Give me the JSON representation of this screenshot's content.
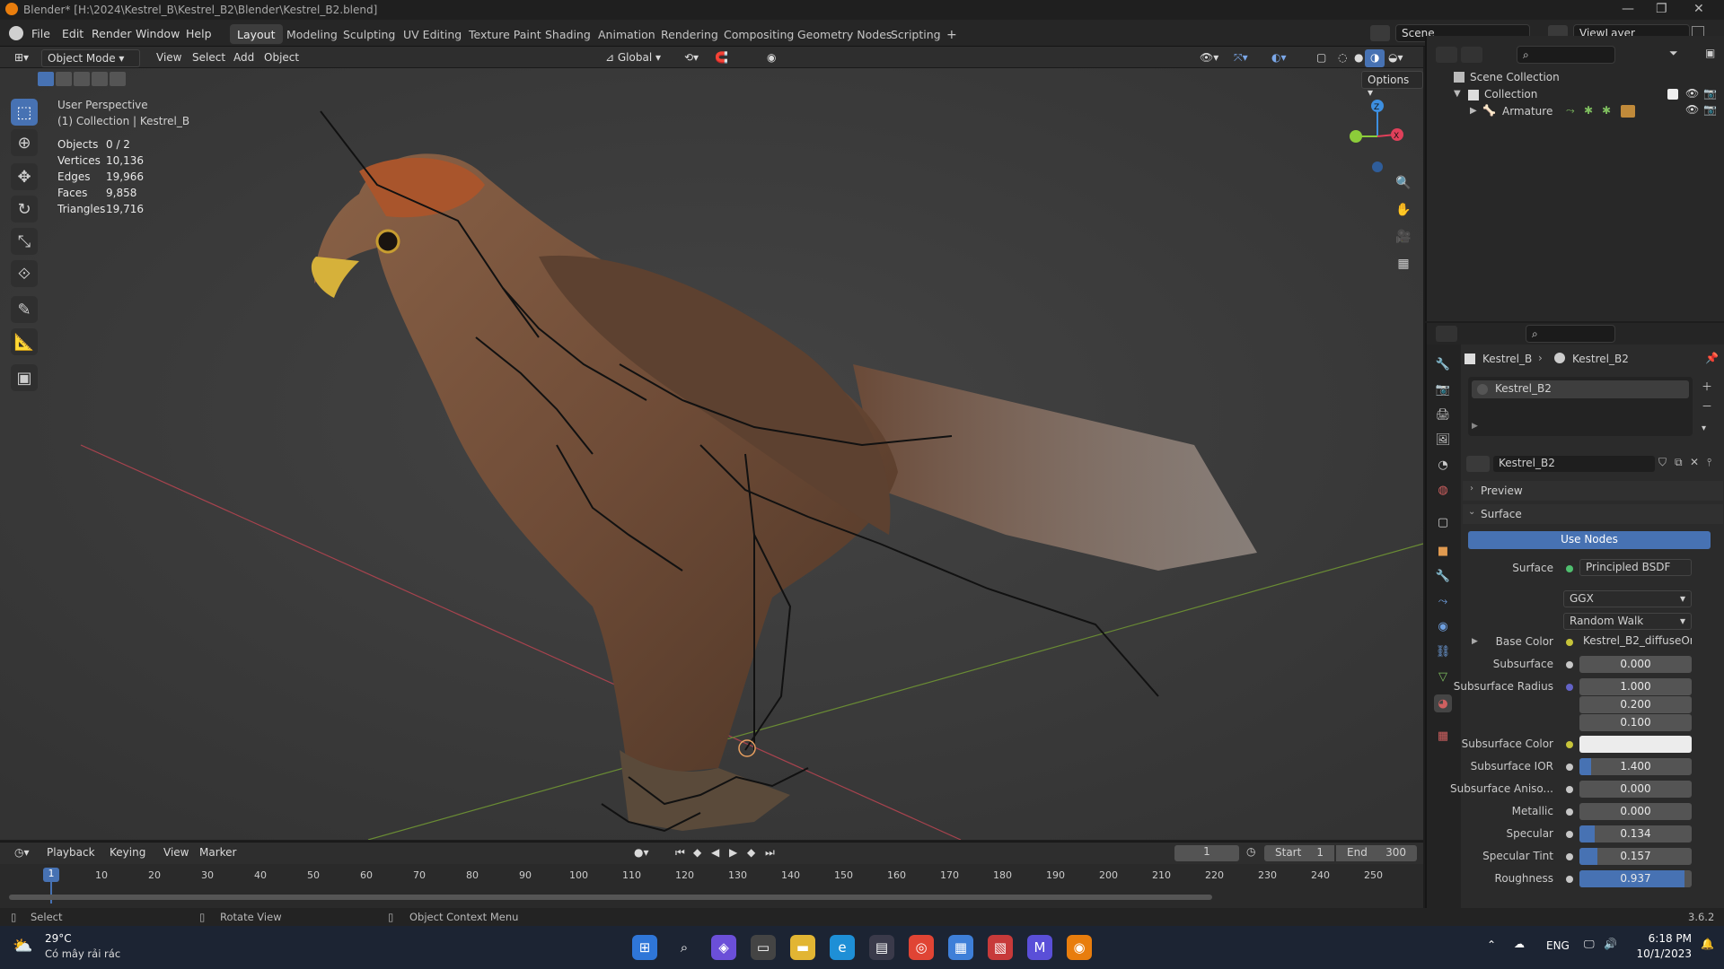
{
  "titlebar": {
    "title": "Blender* [H:\\2024\\Kestrel_B\\Kestrel_B2\\Blender\\Kestrel_B2.blend]"
  },
  "menubar": {
    "menus": [
      "File",
      "Edit",
      "Render",
      "Window",
      "Help"
    ],
    "workspaces": [
      "Layout",
      "Modeling",
      "Sculpting",
      "UV Editing",
      "Texture Paint",
      "Shading",
      "Animation",
      "Rendering",
      "Compositing",
      "Geometry Nodes",
      "Scripting"
    ],
    "active_workspace": "Layout",
    "add_tab": "+",
    "scene": "Scene",
    "view_layer": "ViewLayer"
  },
  "viewport_header": {
    "mode": "Object Mode",
    "menus": [
      "View",
      "Select",
      "Add",
      "Object"
    ],
    "orientation": "Global",
    "options": "Options"
  },
  "viewport": {
    "view_name": "User Perspective",
    "collection": "(1) Collection | Kestrel_B",
    "stats": [
      {
        "label": "Objects",
        "value": "0 / 2"
      },
      {
        "label": "Vertices",
        "value": "10,136"
      },
      {
        "label": "Edges",
        "value": "19,966"
      },
      {
        "label": "Faces",
        "value": "9,858"
      },
      {
        "label": "Triangles",
        "value": "19,716"
      }
    ],
    "gizmo": {
      "z": "Z",
      "x": "X"
    }
  },
  "outliner": {
    "root": "Scene Collection",
    "collection": "Collection",
    "object": "Armature"
  },
  "properties": {
    "breadcrumb_object": "Kestrel_B",
    "breadcrumb_material": "Kestrel_B2",
    "slot_name": "Kestrel_B2",
    "material_name": "Kestrel_B2",
    "preview_label": "Preview",
    "surface_section": "Surface",
    "use_nodes": "Use Nodes",
    "surface_label": "Surface",
    "surface_shader": "Principled BSDF",
    "distribution": "GGX",
    "subsurface_method": "Random Walk",
    "rows": [
      {
        "label": "Base Color",
        "value": "Kestrel_B2_diffuseOrig...",
        "kind": "link"
      },
      {
        "label": "Subsurface",
        "value": "0.000",
        "fill": 0
      },
      {
        "label": "Subsurface Radius",
        "value": "1.000",
        "fill": 0
      },
      {
        "label": "",
        "value": "0.200",
        "fill": 0
      },
      {
        "label": "",
        "value": "0.100",
        "fill": 0
      },
      {
        "label": "Subsurface Color",
        "value": "",
        "kind": "color"
      },
      {
        "label": "Subsurface IOR",
        "value": "1.400",
        "fill": 0.1
      },
      {
        "label": "Subsurface Aniso...",
        "value": "0.000",
        "fill": 0
      },
      {
        "label": "Metallic",
        "value": "0.000",
        "fill": 0
      },
      {
        "label": "Specular",
        "value": "0.134",
        "fill": 0.134
      },
      {
        "label": "Specular Tint",
        "value": "0.157",
        "fill": 0.157
      },
      {
        "label": "Roughness",
        "value": "0.937",
        "fill": 0.937
      }
    ]
  },
  "timeline": {
    "menus": [
      "Playback",
      "Keying",
      "View",
      "Marker"
    ],
    "current_frame": "1",
    "start_label": "Start",
    "start": "1",
    "end_label": "End",
    "end": "300",
    "ticks": [
      "1",
      "10",
      "20",
      "30",
      "40",
      "50",
      "60",
      "70",
      "80",
      "90",
      "100",
      "110",
      "120",
      "130",
      "140",
      "150",
      "160",
      "170",
      "180",
      "190",
      "200",
      "210",
      "220",
      "230",
      "240",
      "250"
    ]
  },
  "statusbar": {
    "select": "Select",
    "rotate": "Rotate View",
    "context": "Object Context Menu",
    "version": "3.6.2"
  },
  "taskbar": {
    "temp": "29°C",
    "weather": "Có mây rải rác",
    "lang": "ENG",
    "time": "6:18 PM",
    "date": "10/1/2023"
  },
  "colors": {
    "accent": "#4772b3",
    "x_axis": "#e0405a",
    "y_axis": "#8ccc3a",
    "z_axis": "#3d8fe0"
  }
}
